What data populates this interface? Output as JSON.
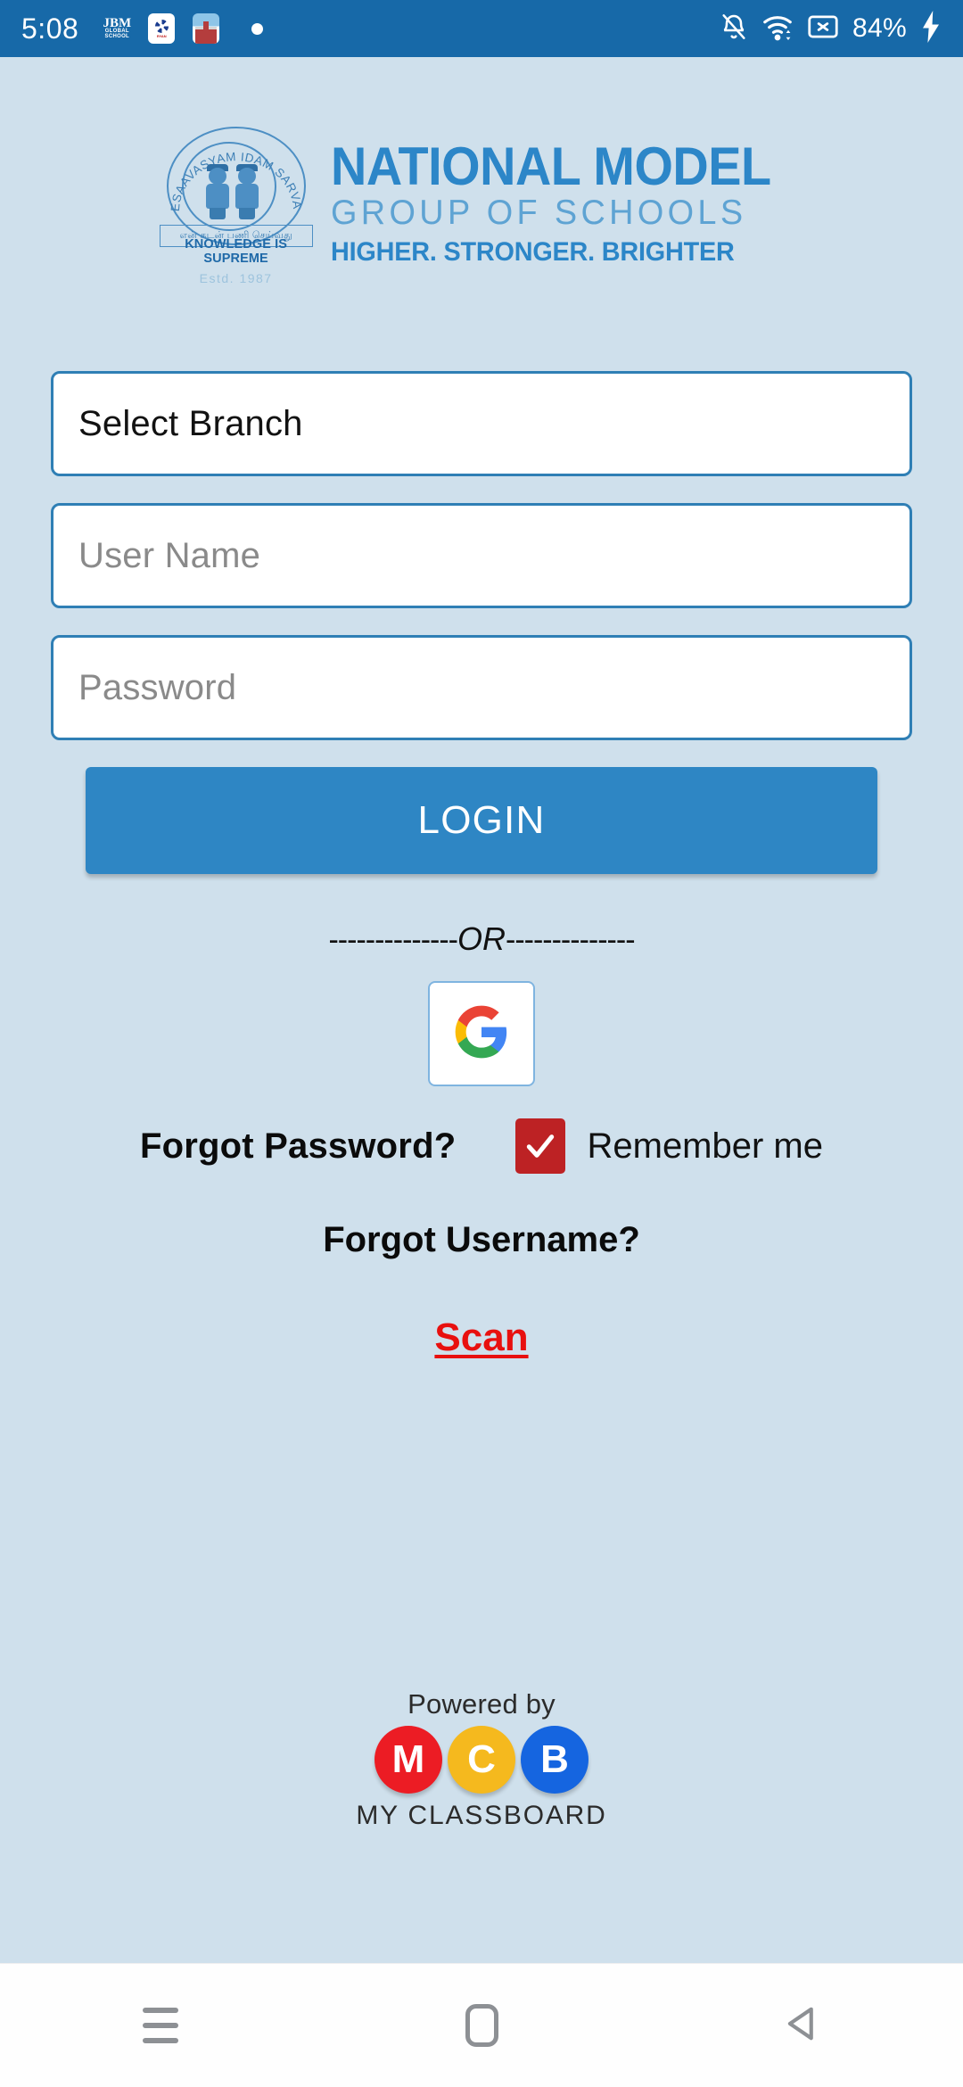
{
  "status_bar": {
    "time": "5:08",
    "app_icons": [
      {
        "name": "jbm-global-school",
        "line1": "JBM",
        "line2": "GLOBAL",
        "line3": "SCHOOL"
      },
      {
        "name": "ryan-school",
        "label": "RYAN"
      },
      {
        "name": "school-building-app",
        "label": ""
      }
    ],
    "dot_indicator": "•",
    "icons": [
      "notifications-silent-icon",
      "wifi-icon",
      "no-sim-icon",
      "charging-bolt-icon"
    ],
    "battery_percent": "84%",
    "background_color": "#1769a8"
  },
  "branding": {
    "seal": {
      "arc_text": "EESAAVASYAM IDAM SARVAM",
      "tamil_motto": "என் கடன் பணி செய்வது",
      "motto_english": "KNOWLEDGE IS SUPREME",
      "established": "Estd. 1987"
    },
    "name_line1": "NATIONAL MODEL",
    "name_line2": "GROUP OF SCHOOLS",
    "tagline": "HIGHER. STRONGER. BRIGHTER",
    "accent_color": "#2c86c8"
  },
  "form": {
    "branch": {
      "value": "Select Branch",
      "placeholder": "Select Branch"
    },
    "username": {
      "value": "",
      "placeholder": "User Name"
    },
    "password": {
      "value": "",
      "placeholder": "Password"
    },
    "login_label": "LOGIN",
    "login_color": "#2e86c4",
    "divider_left": "--------------",
    "divider_word": "OR",
    "divider_right": "--------------",
    "google_button_label": "G",
    "forgot_password_label": "Forgot Password?",
    "remember_me_label": "Remember me",
    "remember_me_checked": true,
    "checkbox_color": "#bd2224",
    "forgot_username_label": "Forgot Username?",
    "scan_label": "Scan",
    "scan_color": "#e8100f"
  },
  "footer": {
    "powered_by": "Powered by",
    "badges": [
      {
        "letter": "M",
        "color": "#ec1c24"
      },
      {
        "letter": "C",
        "color": "#f5b91e"
      },
      {
        "letter": "B",
        "color": "#1565e0"
      }
    ],
    "brand_name": "MY CLASSBOARD"
  },
  "navigation_bar": {
    "recents_label": "Recents",
    "home_label": "Home",
    "back_label": "Back"
  }
}
